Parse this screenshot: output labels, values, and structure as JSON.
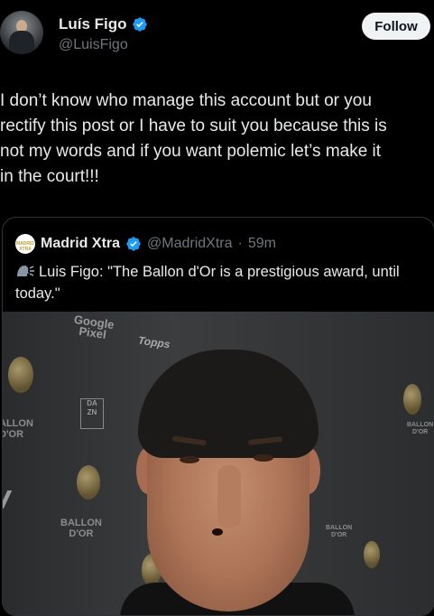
{
  "author": {
    "display_name": "Luís Figo",
    "handle": "@LuisFigo",
    "follow_label": "Follow"
  },
  "tweet": {
    "text": "I don’t know who manage this account but or you\nrectify this post or I have to suit you because this is\nnot my words and if you want polemic let’s make it\nin the court!!!"
  },
  "quote": {
    "avatar_text": "MADRID XTRA",
    "display_name": "Madrid Xtra",
    "handle": "@MadridXtra",
    "separator": "·",
    "time": "59m",
    "text": "Luis Figo: \"The Ballon d'Or is a prestigious award, until today.\"",
    "photo": {
      "sponsor_text": "Google\nPixel",
      "topps_text": "Topps",
      "dazn_text": "DA\nZN",
      "ballon_dor_texts": [
        "ALLON\nD'OR",
        "BALLON\nD'OR",
        "BALLON\nD'OR",
        "BALLON\nD'OR"
      ]
    }
  },
  "colors": {
    "background": "#000000",
    "text": "#e7e9ea",
    "muted": "#71767b",
    "verified": "#1d9bf0",
    "follow_bg": "#eff3f4"
  }
}
